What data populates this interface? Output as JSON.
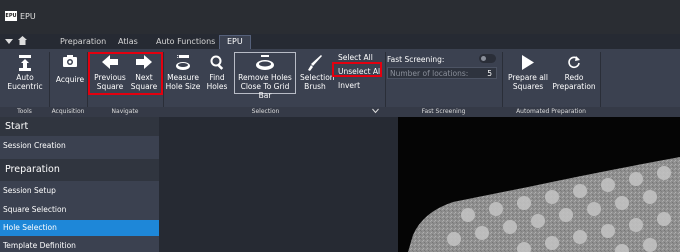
{
  "app": {
    "logo_text": "EPU",
    "title": "EPU"
  },
  "tabs": [
    {
      "label": "Preparation",
      "active": false
    },
    {
      "label": "Atlas",
      "active": false
    },
    {
      "label": "Auto Functions",
      "active": false
    },
    {
      "label": "EPU",
      "active": true
    }
  ],
  "quick_controls": {
    "menu_icon": "caret-down-icon",
    "home_icon": "home-icon"
  },
  "ribbon": {
    "tools": {
      "auto_eucentric": "Auto\nEucentric",
      "group_label": "Tools"
    },
    "acquisition": {
      "acquire": "Acquire",
      "group_label": "Acquisition"
    },
    "navigate": {
      "previous_square": "Previous\nSquare",
      "next_square": "Next\nSquare",
      "group_label": "Navigate"
    },
    "selection": {
      "measure_hole_size": "Measure\nHole Size",
      "find_holes": "Find\nHoles",
      "remove_holes": "Remove Holes\nClose To Grid Bar",
      "selection_brush": "Selection\nBrush",
      "select_all": "Select All",
      "unselect_all": "Unselect All",
      "invert": "Invert",
      "group_label": "Selection"
    },
    "fast_screening": {
      "title": "Fast Screening:",
      "number_placeholder": "Number of locations:",
      "number_value": "5",
      "group_label": "Fast Screening",
      "enabled": false
    },
    "automated_preparation": {
      "prepare_all_squares": "Prepare all\nSquares",
      "redo_preparation": "Redo\nPreparation",
      "group_label": "Automated Preparation"
    }
  },
  "sidebar": {
    "start": {
      "header": "Start",
      "items": [
        "Session Creation"
      ]
    },
    "preparation": {
      "header": "Preparation",
      "items": [
        "Session Setup",
        "Square Selection",
        "Hole Selection",
        "Template Definition"
      ],
      "selected": "Hole Selection"
    }
  },
  "colors": {
    "ribbon_bg": "#3b4150",
    "title_bg": "#2a2d33",
    "selected_item": "#1e87d8",
    "highlight_box": "#e3000f"
  }
}
